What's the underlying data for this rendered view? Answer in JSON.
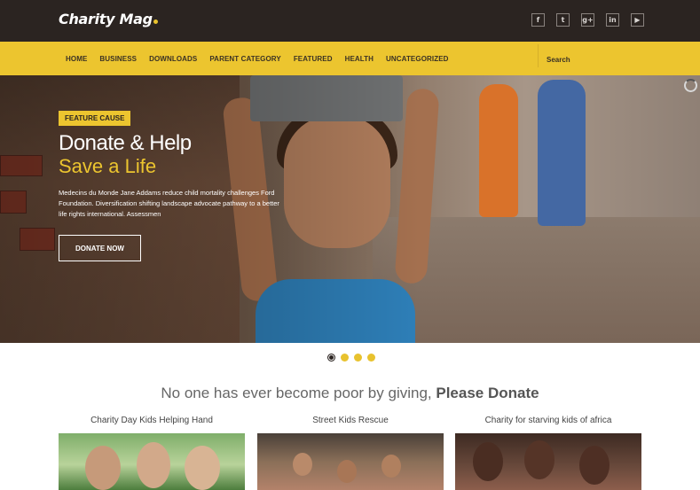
{
  "brand": {
    "name": "Charity Mag",
    "accent": "#ecc52f",
    "dark": "#2b2421"
  },
  "social": [
    {
      "icon": "facebook-icon",
      "glyph": "f"
    },
    {
      "icon": "twitter-icon",
      "glyph": "t"
    },
    {
      "icon": "google-plus-icon",
      "glyph": "g+"
    },
    {
      "icon": "linkedin-icon",
      "glyph": "in"
    },
    {
      "icon": "youtube-icon",
      "glyph": "▶"
    }
  ],
  "nav": {
    "items": [
      "HOME",
      "BUSINESS",
      "DOWNLOADS",
      "PARENT CATEGORY",
      "FEATURED",
      "HEALTH",
      "UNCATEGORIZED"
    ],
    "search_placeholder": "Search"
  },
  "hero": {
    "tag": "FEATURE CAUSE",
    "title": "Donate & Help",
    "subtitle": "Save a Life",
    "description": "Medecins du Monde Jane Addams reduce child mortality challenges Ford Foundation. Diversification shifting landscape advocate pathway to a better life rights international. Assessmen",
    "button": "DONATE NOW"
  },
  "slider": {
    "count": 4,
    "active": 1
  },
  "tagline": {
    "text": "No one has ever become poor by giving, ",
    "bold": "Please Donate"
  },
  "cards": [
    {
      "title": "Charity Day Kids Helping Hand"
    },
    {
      "title": "Street Kids Rescue"
    },
    {
      "title": "Charity for starving kids of africa"
    }
  ]
}
